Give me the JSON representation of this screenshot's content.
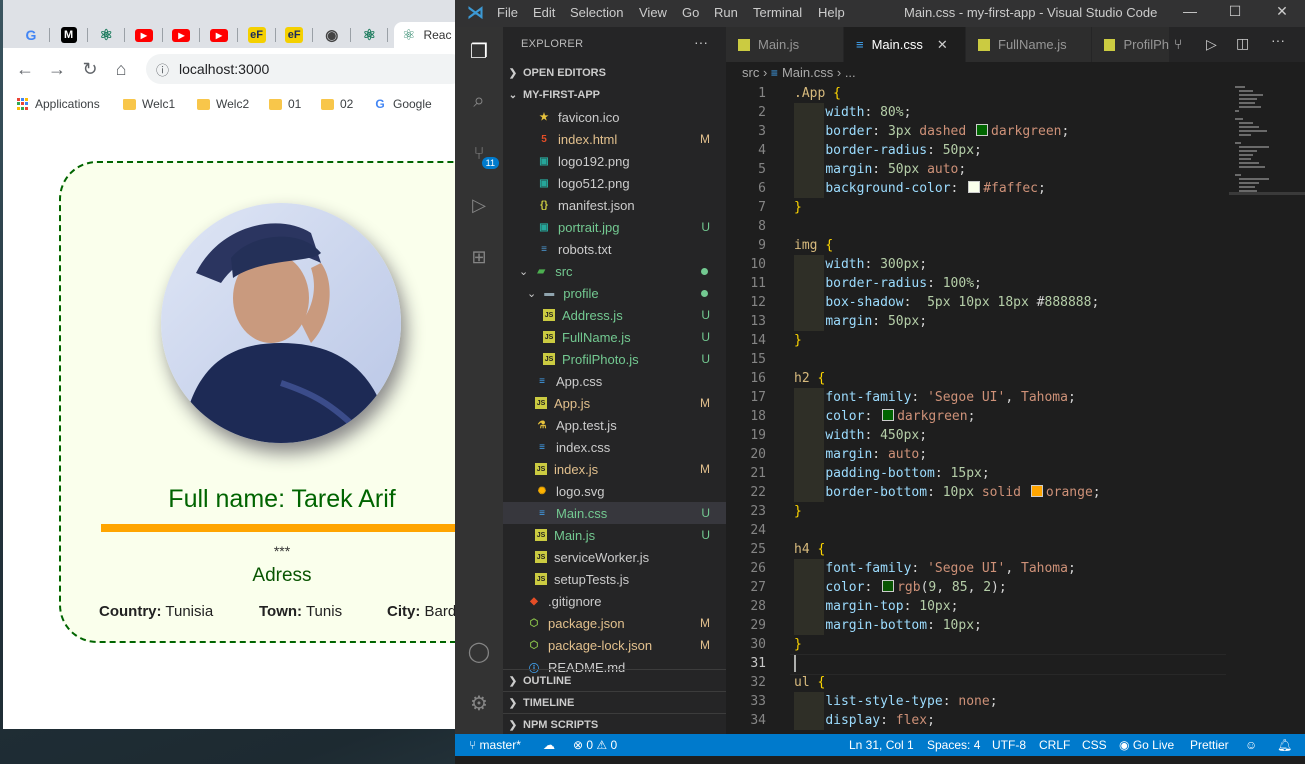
{
  "browser": {
    "tabs": [
      {
        "icon": "google-icon",
        "glyph": "G",
        "color": "#ffffff"
      },
      {
        "icon": "medium-icon",
        "glyph": "M",
        "color": "#000000"
      },
      {
        "icon": "react-icon",
        "glyph": "⚛",
        "color": "#1e7d5f"
      },
      {
        "icon": "youtube-icon",
        "glyph": "▶",
        "color": "#ff0000"
      },
      {
        "icon": "youtube-icon",
        "glyph": "▶",
        "color": "#ff0000"
      },
      {
        "icon": "youtube-icon",
        "glyph": "▶",
        "color": "#ff0000"
      },
      {
        "icon": "ef-icon",
        "glyph": "eF",
        "color": "#f4d000"
      },
      {
        "icon": "ef-icon",
        "glyph": "eF",
        "color": "#f4d000"
      },
      {
        "icon": "globe-icon",
        "glyph": "◉",
        "color": "#444444"
      },
      {
        "icon": "react-icon",
        "glyph": "⚛",
        "color": "#1e7d5f"
      }
    ],
    "active_tab": {
      "label": "Reac",
      "icon": "react-icon"
    },
    "url": "localhost:3000",
    "bookmarks": {
      "apps": "Applications",
      "items": [
        "Welc1",
        "Welc2",
        "01",
        "02"
      ],
      "google": "Google"
    },
    "page": {
      "full_name": "Full name: Tarek Arif",
      "stars": "***",
      "adress_title": "Adress",
      "country_label": "Country:",
      "country_value": " Tunisia",
      "town_label": "Town:",
      "town_value": " Tunis",
      "city_label": "City:",
      "city_value": " Bard"
    }
  },
  "vscode": {
    "menu": [
      "File",
      "Edit",
      "Selection",
      "View",
      "Go",
      "Run",
      "Terminal",
      "Help"
    ],
    "title": "Main.css - my-first-app - Visual Studio Code",
    "explorer_label": "EXPLORER",
    "explorer_more": "···",
    "sections": {
      "open_editors": "OPEN EDITORS",
      "project": "MY-FIRST-APP",
      "outline": "OUTLINE",
      "timeline": "TIMELINE",
      "npm": "NPM SCRIPTS"
    },
    "source_control_badge": "11",
    "files": [
      {
        "name": "favicon.ico",
        "badge": "",
        "icon": "star-icon",
        "color": "#ccc"
      },
      {
        "name": "index.html",
        "badge": "M",
        "icon": "html-icon",
        "color": "#e2c08d"
      },
      {
        "name": "logo192.png",
        "badge": "",
        "icon": "image-icon",
        "color": "#ccc"
      },
      {
        "name": "logo512.png",
        "badge": "",
        "icon": "image-icon",
        "color": "#ccc"
      },
      {
        "name": "manifest.json",
        "badge": "",
        "icon": "json-icon",
        "color": "#ccc"
      },
      {
        "name": "portrait.jpg",
        "badge": "U",
        "icon": "image-icon",
        "color": "#73c991"
      },
      {
        "name": "robots.txt",
        "badge": "",
        "icon": "text-icon",
        "color": "#ccc"
      },
      {
        "name": "src",
        "badge": "",
        "icon": "folder-src-icon",
        "color": "#73c991"
      },
      {
        "name": "profile",
        "badge": "",
        "icon": "folder-icon",
        "color": "#73c991"
      },
      {
        "name": "Address.js",
        "badge": "U",
        "icon": "js-icon",
        "color": "#73c991"
      },
      {
        "name": "FullName.js",
        "badge": "U",
        "icon": "js-icon",
        "color": "#73c991"
      },
      {
        "name": "ProfilPhoto.js",
        "badge": "U",
        "icon": "js-icon",
        "color": "#73c991"
      },
      {
        "name": "App.css",
        "badge": "",
        "icon": "css-icon",
        "color": "#ccc"
      },
      {
        "name": "App.js",
        "badge": "M",
        "icon": "js-icon",
        "color": "#e2c08d"
      },
      {
        "name": "App.test.js",
        "badge": "",
        "icon": "test-icon",
        "color": "#ccc"
      },
      {
        "name": "index.css",
        "badge": "",
        "icon": "css-icon",
        "color": "#ccc"
      },
      {
        "name": "index.js",
        "badge": "M",
        "icon": "js-icon",
        "color": "#e2c08d"
      },
      {
        "name": "logo.svg",
        "badge": "",
        "icon": "svg-icon",
        "color": "#ccc"
      },
      {
        "name": "Main.css",
        "badge": "U",
        "icon": "css-icon",
        "color": "#73c991"
      },
      {
        "name": "Main.js",
        "badge": "U",
        "icon": "js-icon",
        "color": "#73c991"
      },
      {
        "name": "serviceWorker.js",
        "badge": "",
        "icon": "js-icon",
        "color": "#ccc"
      },
      {
        "name": "setupTests.js",
        "badge": "",
        "icon": "js-icon",
        "color": "#ccc"
      },
      {
        "name": ".gitignore",
        "badge": "",
        "icon": "git-icon",
        "color": "#ccc"
      },
      {
        "name": "package.json",
        "badge": "M",
        "icon": "npm-icon",
        "color": "#e2c08d"
      },
      {
        "name": "package-lock.json",
        "badge": "M",
        "icon": "npm-icon",
        "color": "#e2c08d"
      },
      {
        "name": "README.md",
        "badge": "",
        "icon": "info-icon",
        "color": "#ccc"
      }
    ],
    "editor_tabs": [
      "Main.js",
      "Main.css",
      "FullName.js",
      "ProfilPh"
    ],
    "active_editor_tab": "Main.css",
    "breadcrumb": {
      "folder": "src",
      "file": "Main.css",
      "more": "..."
    },
    "code_lines": [
      ".App {",
      "    width: 80%;",
      "    border: 3px dashed darkgreen;",
      "    border-radius: 50px;",
      "    margin: 50px auto;",
      "    background-color: #faffec;",
      "}",
      "",
      "img {",
      "    width: 300px;",
      "    border-radius: 100%;",
      "    box-shadow:  5px 10px 18px #888888;",
      "    margin: 50px;",
      "}",
      "",
      "h2 {",
      "    font-family: 'Segoe UI', Tahoma;",
      "    color: darkgreen;",
      "    width: 450px;",
      "    margin: auto;",
      "    padding-bottom: 15px;",
      "    border-bottom: 10px solid orange;",
      "}",
      "",
      "h4 {",
      "    font-family: 'Segoe UI', Tahoma;",
      "    color: rgb(9, 85, 2);",
      "    margin-top: 10px;",
      "    margin-bottom: 10px;",
      "}",
      "",
      "ul {",
      "    list-style-type: none;",
      "    display: flex;"
    ],
    "current_line": 31,
    "status": {
      "branch": "master*",
      "problems": "⊗ 0 ⚠ 0",
      "position": "Ln 31, Col 1",
      "spaces": "Spaces: 4",
      "encoding": "UTF-8",
      "eol": "CRLF",
      "language": "CSS",
      "golive": "Go Live",
      "prettier": "Prettier"
    }
  }
}
